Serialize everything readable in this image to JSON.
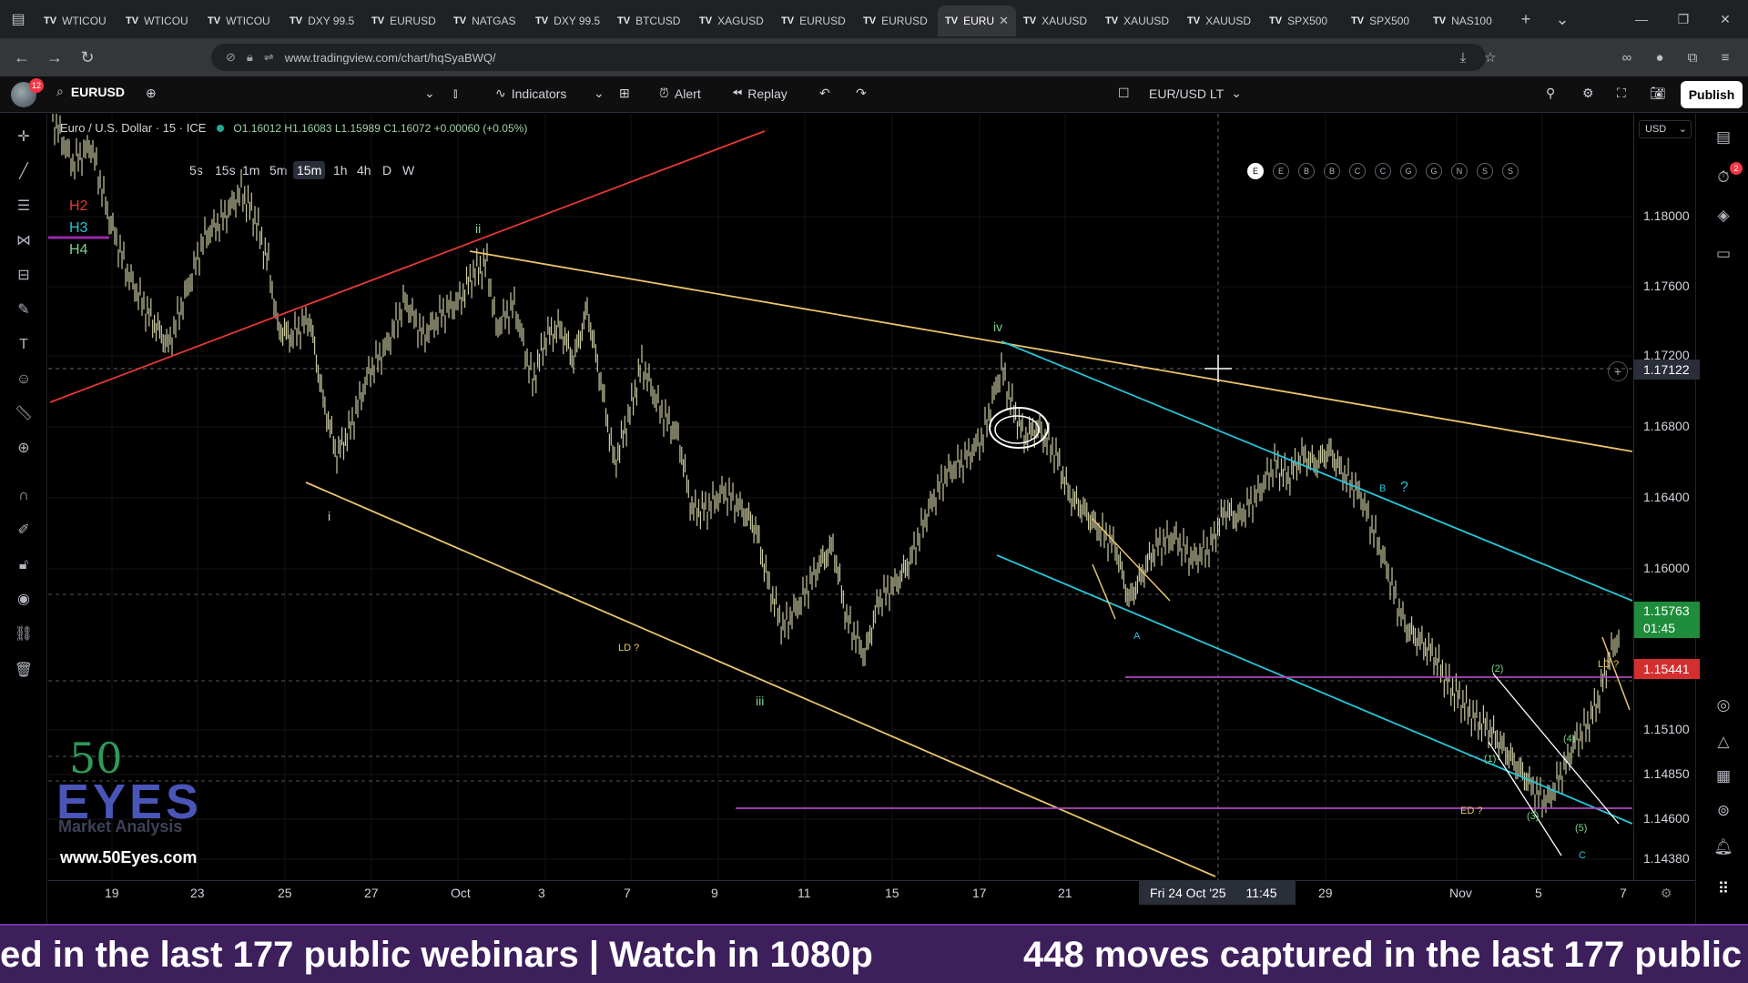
{
  "browser": {
    "tabs": [
      {
        "label": "WTICOU"
      },
      {
        "label": "WTICOU"
      },
      {
        "label": "WTICOU"
      },
      {
        "label": "DXY 99.5"
      },
      {
        "label": "EURUSD"
      },
      {
        "label": "NATGAS"
      },
      {
        "label": "DXY 99.5"
      },
      {
        "label": "BTCUSD"
      },
      {
        "label": "XAGUSD"
      },
      {
        "label": "EURUSD"
      },
      {
        "label": "EURUSD"
      },
      {
        "label": "EURU",
        "active": true
      },
      {
        "label": "XAUUSD"
      },
      {
        "label": "XAUUSD"
      },
      {
        "label": "XAUUSD"
      },
      {
        "label": "SPX500"
      },
      {
        "label": "SPX500"
      },
      {
        "label": "NAS100"
      }
    ],
    "tab_prefix": "TV",
    "url": "www.tradingview.com/chart/hqSyaBWQ/"
  },
  "toolbar": {
    "avatar_badge": "12",
    "symbol": "EURUSD",
    "timeframes": [
      "5s",
      "15s",
      "1m",
      "5m",
      "15m",
      "1h",
      "4h",
      "D",
      "W"
    ],
    "active_timeframe": "15m",
    "indicators_label": "Indicators",
    "alert_label": "Alert",
    "replay_label": "Replay",
    "watchlist_label": "EUR/USD LT",
    "letters": [
      "E",
      "E",
      "B",
      "B",
      "C",
      "C",
      "G",
      "G",
      "N",
      "S",
      "S"
    ],
    "publish_label": "Publish"
  },
  "chart": {
    "title": "Euro / U.S. Dollar · 15 · ICE",
    "ohlc": "O1.16012 H1.16083 L1.15989 C1.16072 +0.00060 (+0.05%)",
    "currency": "USD",
    "price_levels": [
      "1.18000",
      "1.17600",
      "1.17200",
      "1.16800",
      "1.16400",
      "1.16000",
      "1.15100",
      "1.14850",
      "1.14600",
      "1.14380"
    ],
    "crosshair_price": "1.17122",
    "last_price": "1.15763",
    "countdown": "01:45",
    "red_level_price": "1.15441",
    "time_labels": [
      "19",
      "23",
      "25",
      "27",
      "Oct",
      "3",
      "7",
      "9",
      "11",
      "15",
      "17",
      "21",
      "29",
      "Nov",
      "5",
      "7"
    ],
    "crosshair_date": "Fri 24 Oct '25",
    "crosshair_time": "11:45",
    "wave_labels": {
      "i": "i",
      "ii": "ii",
      "iii": "iii",
      "iv": "iv",
      "ld1": "LD ?",
      "ld2": "LD ?",
      "ed": "ED ?",
      "A": "A",
      "B": "B",
      "C": "C",
      "q": "?",
      "w1": "(1)",
      "w2": "(2)",
      "w3": "(3)",
      "w4": "(4)",
      "w5": "(5)",
      "h2": "H2",
      "h3": "H3",
      "h4": "H4"
    },
    "colors": {
      "yellow_trend": "#e9c46a",
      "red_trend": "#e53935",
      "cyan_channel": "#26c6da",
      "purple_level": "#ab47bc",
      "candles": "#c9c9a0",
      "last_price_tag": "#1e8c3a",
      "red_price_tag": "#d32f2f"
    }
  },
  "watermark": {
    "num": "50",
    "brand": "EYES",
    "tagline": "Market Analysis",
    "url": "www.50Eyes.com"
  },
  "banner": {
    "text_left": "ed in the last 177 public webinars | Watch in 1080p",
    "text_right": "448 moves captured in the last 177 public"
  }
}
